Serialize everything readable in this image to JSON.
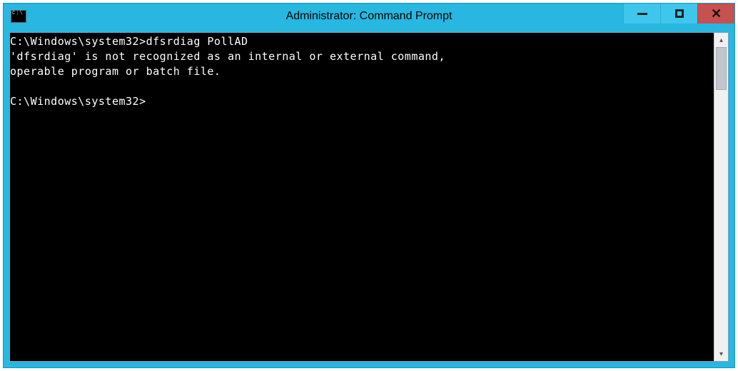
{
  "window": {
    "title": "Administrator: Command Prompt",
    "icon_label": "C:\\"
  },
  "controls": {
    "minimize": "Minimize",
    "maximize": "Maximize",
    "close": "Close"
  },
  "console": {
    "lines": [
      {
        "prompt": "C:\\Windows\\system32>",
        "command": "dfsrdiag PollAD"
      },
      {
        "output": "'dfsrdiag' is not recognized as an internal or external command,"
      },
      {
        "output": "operable program or batch file."
      },
      {
        "output": ""
      },
      {
        "prompt": "C:\\Windows\\system32>",
        "command": ""
      }
    ]
  },
  "colors": {
    "titlebar": "#27b7e1",
    "close_button": "#c75050",
    "console_bg": "#000000",
    "console_fg": "#ffffff"
  }
}
